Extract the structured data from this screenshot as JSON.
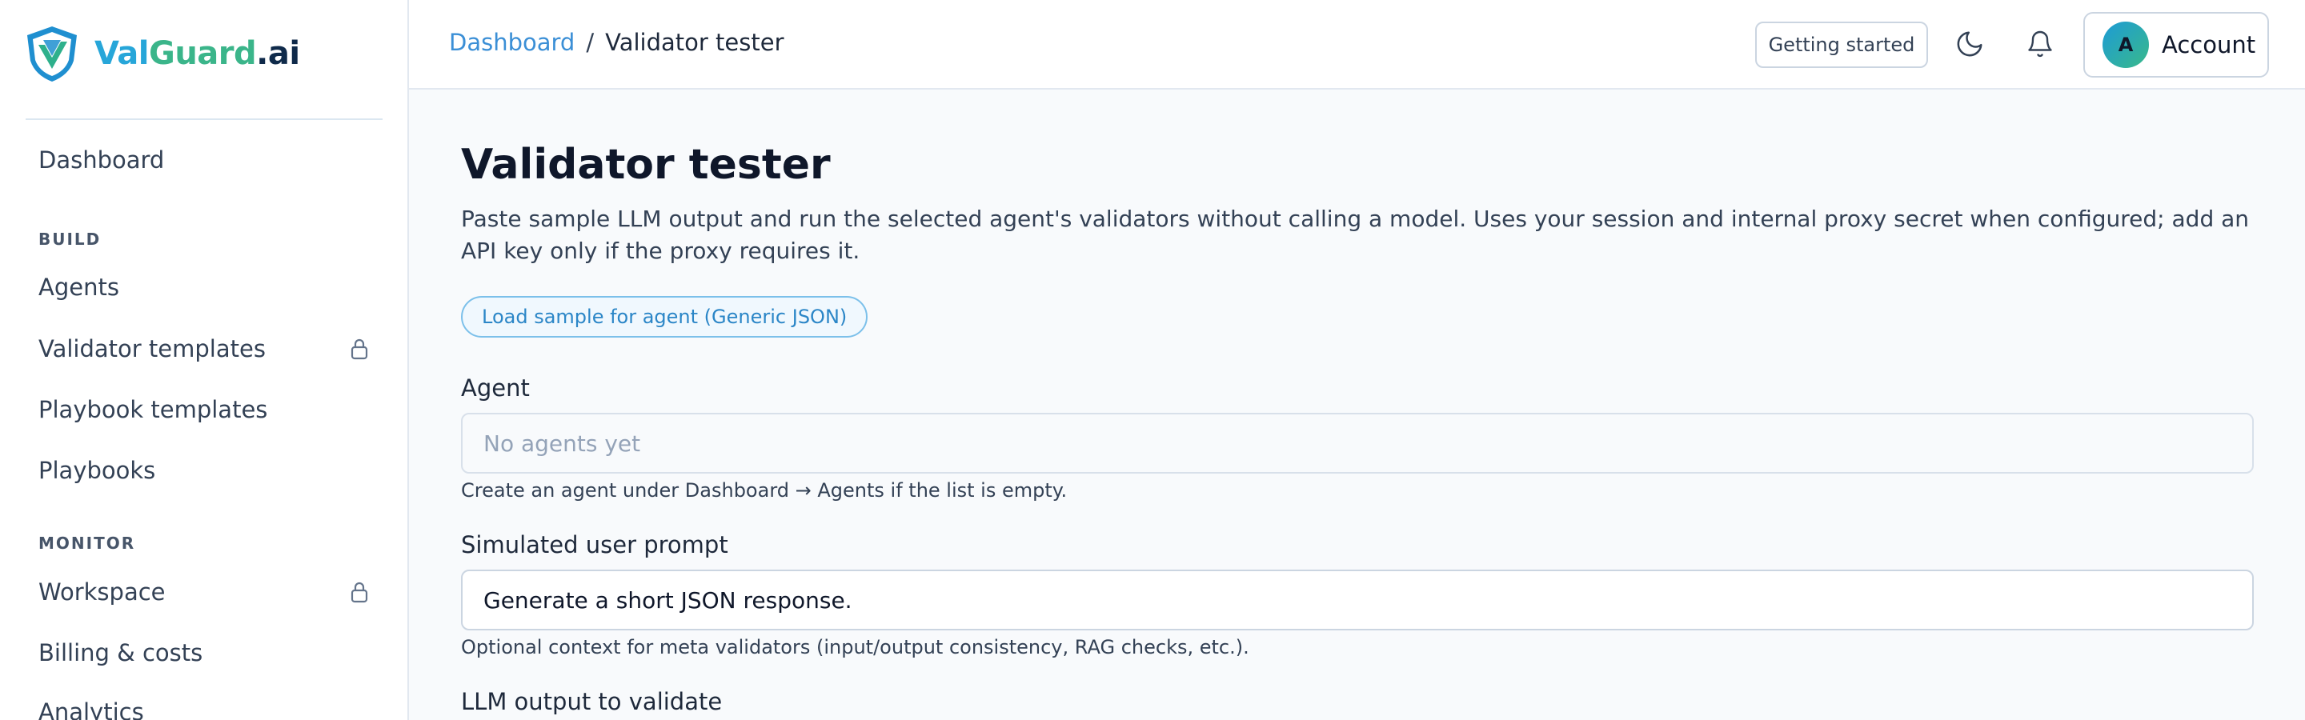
{
  "brand": {
    "part1": "Val",
    "part2": "Guard",
    "part3": ".ai"
  },
  "sidebar": {
    "dashboard": "Dashboard",
    "sections": {
      "build": "BUILD",
      "monitor": "MONITOR"
    },
    "build_items": [
      {
        "label": "Agents",
        "locked": false
      },
      {
        "label": "Validator templates",
        "locked": true
      },
      {
        "label": "Playbook templates",
        "locked": false
      },
      {
        "label": "Playbooks",
        "locked": false
      }
    ],
    "monitor_items": [
      {
        "label": "Workspace",
        "locked": true
      },
      {
        "label": "Billing & costs",
        "locked": false
      },
      {
        "label": "Analytics",
        "locked": false
      }
    ]
  },
  "header": {
    "breadcrumb": {
      "root": "Dashboard",
      "separator": "/",
      "current": "Validator tester"
    },
    "getting_started": "Getting started",
    "theme_icon": "moon-icon",
    "notifications_icon": "bell-icon",
    "avatar_initial": "A",
    "account_label": "Account"
  },
  "main": {
    "title": "Validator tester",
    "description": "Paste sample LLM output and run the selected agent's validators without calling a model. Uses your session and internal proxy secret when configured; add an API key only if the proxy requires it.",
    "load_sample_button": "Load sample for agent (Generic JSON)",
    "agent": {
      "label": "Agent",
      "placeholder": "No agents yet",
      "help": "Create an agent under Dashboard → Agents if the list is empty."
    },
    "prompt": {
      "label": "Simulated user prompt",
      "value": "Generate a short JSON response.",
      "help": "Optional context for meta validators (input/output consistency, RAG checks, etc.)."
    },
    "output": {
      "label": "LLM output to validate"
    }
  },
  "colors": {
    "accent": "#3b8fd6",
    "brand_blue": "#27a6d9",
    "brand_green": "#3bb58a",
    "title": "#0f172a",
    "background": "#f8fafc"
  }
}
